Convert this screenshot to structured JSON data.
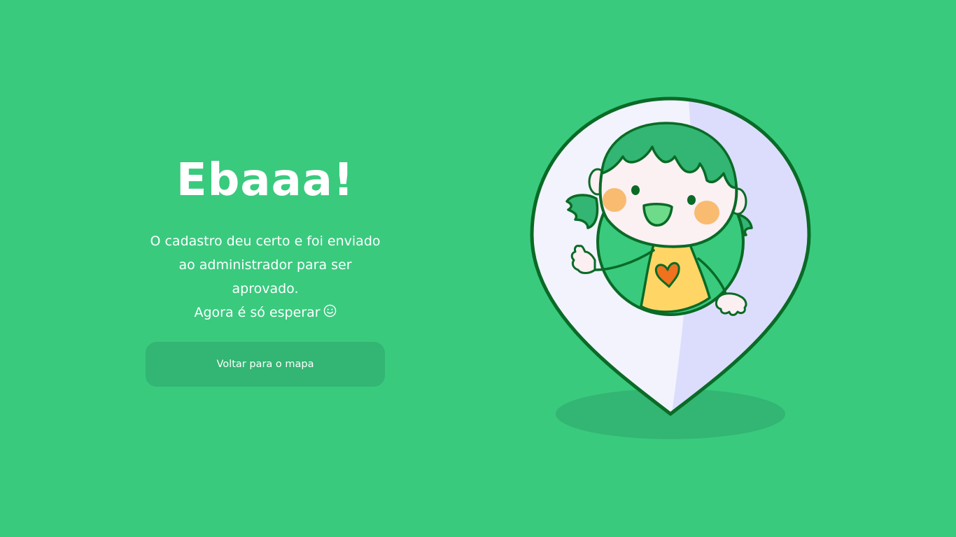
{
  "success": {
    "title": "Ebaaa!",
    "message_line1": "O cadastro deu certo e foi enviado",
    "message_line2": "ao administrador para ser aprovado.",
    "message_line3": "Agora é só esperar",
    "message_icon": "smiley-icon",
    "button_label": "Voltar para o mapa"
  },
  "colors": {
    "background": "#39CA7E",
    "button": "#33B573",
    "text": "#FFFFFF",
    "pin_fill": "#F2F3FC",
    "pin_shade": "#DCDDFD",
    "outline": "#0A6A26"
  },
  "illustration": {
    "icon": "map-pin-girl-illustration"
  }
}
